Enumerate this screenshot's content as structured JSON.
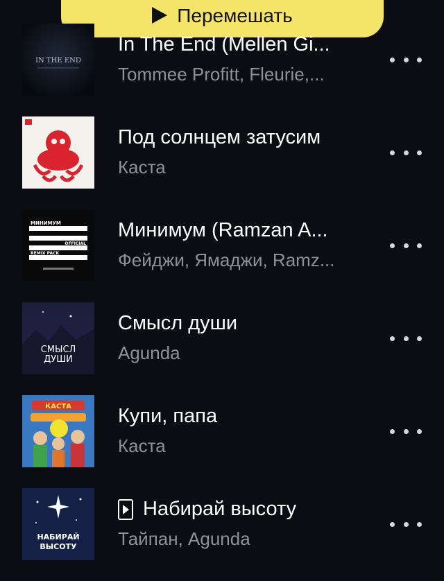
{
  "shuffle": {
    "label": "Перемешать"
  },
  "tracks": [
    {
      "title": "In The End (Mellen Gi...",
      "artist": "Tommee Profitt, Fleurie,...",
      "cover_text": "IN THE END",
      "video": false
    },
    {
      "title": "Под солнцем затусим",
      "artist": "Каста",
      "cover_text": "",
      "video": false
    },
    {
      "title": "Минимум (Ramzan A...",
      "artist": "Фейджи, Ямаджи, Ramz...",
      "cover_text": "МИНИМУМ",
      "cover_text2": "OFFICIAL",
      "cover_text3": "REMIX PACK",
      "video": false
    },
    {
      "title": "Смысл души",
      "artist": "Agunda",
      "cover_text": "СМЫСЛ",
      "cover_text2": "ДУШИ",
      "video": false
    },
    {
      "title": "Купи, папа",
      "artist": "Каста",
      "cover_text": "КАСТА",
      "video": false
    },
    {
      "title": "Набирай высоту",
      "artist": "Тайпан, Agunda",
      "cover_text": "НАБИРАЙ",
      "cover_text2": "ВЫСОТУ",
      "video": true
    }
  ],
  "colors": {
    "background": "#0b0d12",
    "accent": "#f4e56a",
    "subtitle": "#8c929c",
    "touch_indicator": "#f3e331"
  },
  "icons": {
    "shuffle": "play-icon",
    "more": "more-horizontal-icon",
    "video": "video-clip-icon"
  }
}
